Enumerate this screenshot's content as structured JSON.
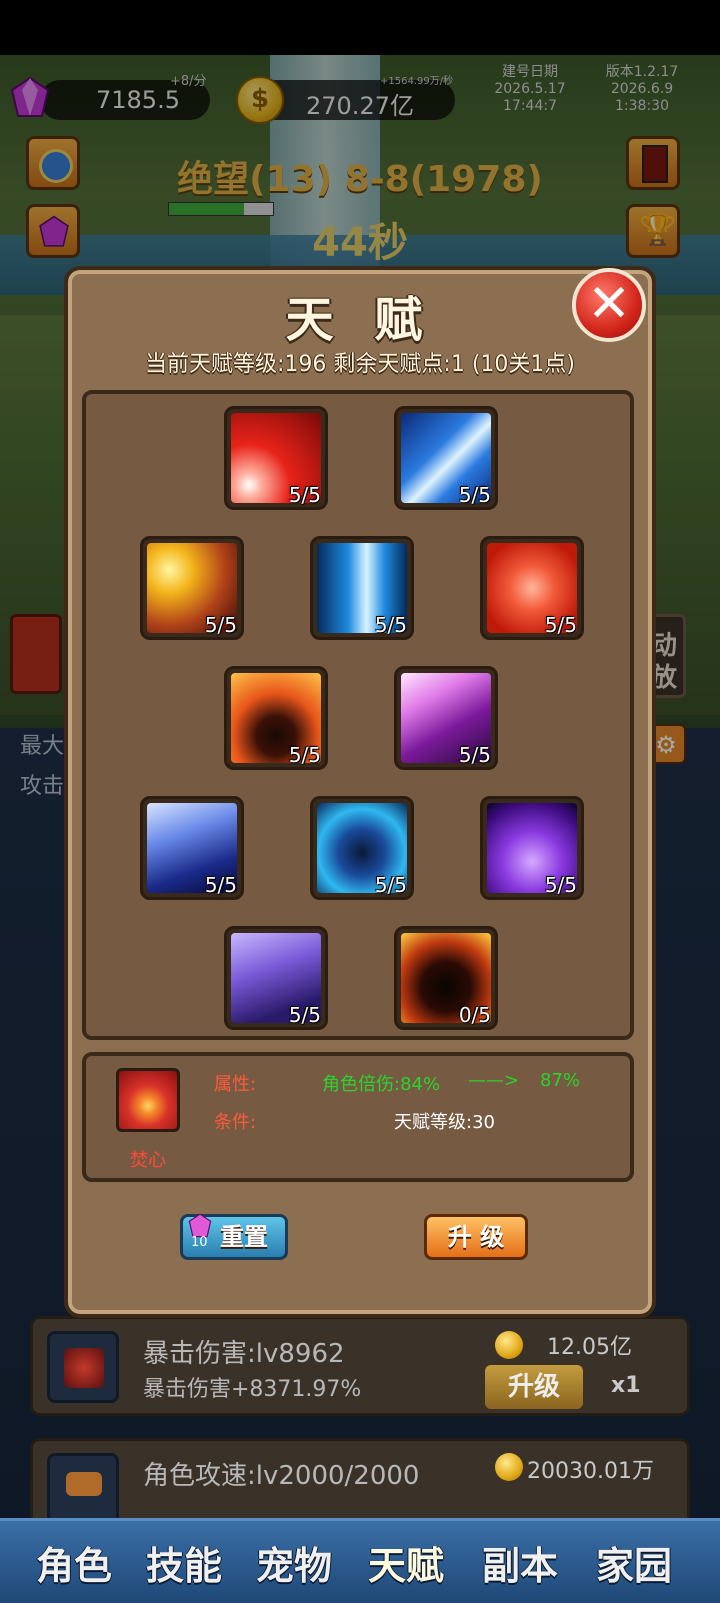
{
  "hud": {
    "gems": "7185.5",
    "gem_rate": "+8/分",
    "gold": "270.27亿",
    "gold_rate": "+1564.99万/秒",
    "build_label": "建号日期",
    "build_date": "2026.5.17",
    "build_time": "17:44:7",
    "version_label": "版本1.2.17",
    "version_date": "2026.6.9",
    "version_time": "1:38:30"
  },
  "stage": {
    "title": "绝望(13) 8-8(1978)",
    "timer": "44秒",
    "hp_fraction": 0.72
  },
  "background": {
    "left_partial_1": "最大",
    "left_partial_2": "攻击",
    "right_partial_1": "动",
    "right_partial_2": "放"
  },
  "dialog": {
    "title": "天 赋",
    "subtitle": "当前天赋等级:196   剩余天赋点:1 (10关1点)",
    "talents": [
      {
        "icon": "red-slash-icon",
        "level": "5/5"
      },
      {
        "icon": "blue-blade-icon",
        "level": "5/5"
      },
      {
        "icon": "golden-punch-icon",
        "level": "5/5"
      },
      {
        "icon": "blue-arrow-icon",
        "level": "5/5"
      },
      {
        "icon": "flexed-arm-icon",
        "level": "5/5"
      },
      {
        "icon": "burning-body-icon",
        "level": "5/5"
      },
      {
        "icon": "purple-drill-icon",
        "level": "5/5"
      },
      {
        "icon": "ice-shards-icon",
        "level": "5/5"
      },
      {
        "icon": "meditation-icon",
        "level": "5/5"
      },
      {
        "icon": "turtle-shield-icon",
        "level": "5/5"
      },
      {
        "icon": "claw-icon",
        "level": "5/5"
      },
      {
        "icon": "halo-head-icon",
        "level": "0/5"
      }
    ],
    "selected": {
      "name": "焚心",
      "attr_label": "属性:",
      "attr_from": "角色倍伤:84%",
      "arrow": "——>",
      "attr_to": "87%",
      "cond_label": "条件:",
      "cond_value": "天赋等级:30"
    },
    "reset_cost": "10",
    "reset_label": "重置",
    "upgrade_label": "升 级"
  },
  "rows": [
    {
      "title": "暴击伤害:lv8962",
      "desc": "暴击伤害+8371.97%",
      "cost": "12.05亿",
      "button": "升级",
      "mult": "x1"
    },
    {
      "title": "角色攻速:lv2000/2000",
      "cost": "20030.01万"
    }
  ],
  "tabs": [
    "角色",
    "技能",
    "宠物",
    "天赋",
    "副本",
    "家园"
  ],
  "colors": {
    "dialog_bg": "#8c6e51",
    "green_value": "#2bd42b",
    "red_label": "#ff5a3a",
    "tabbar": "#2a5a90"
  }
}
